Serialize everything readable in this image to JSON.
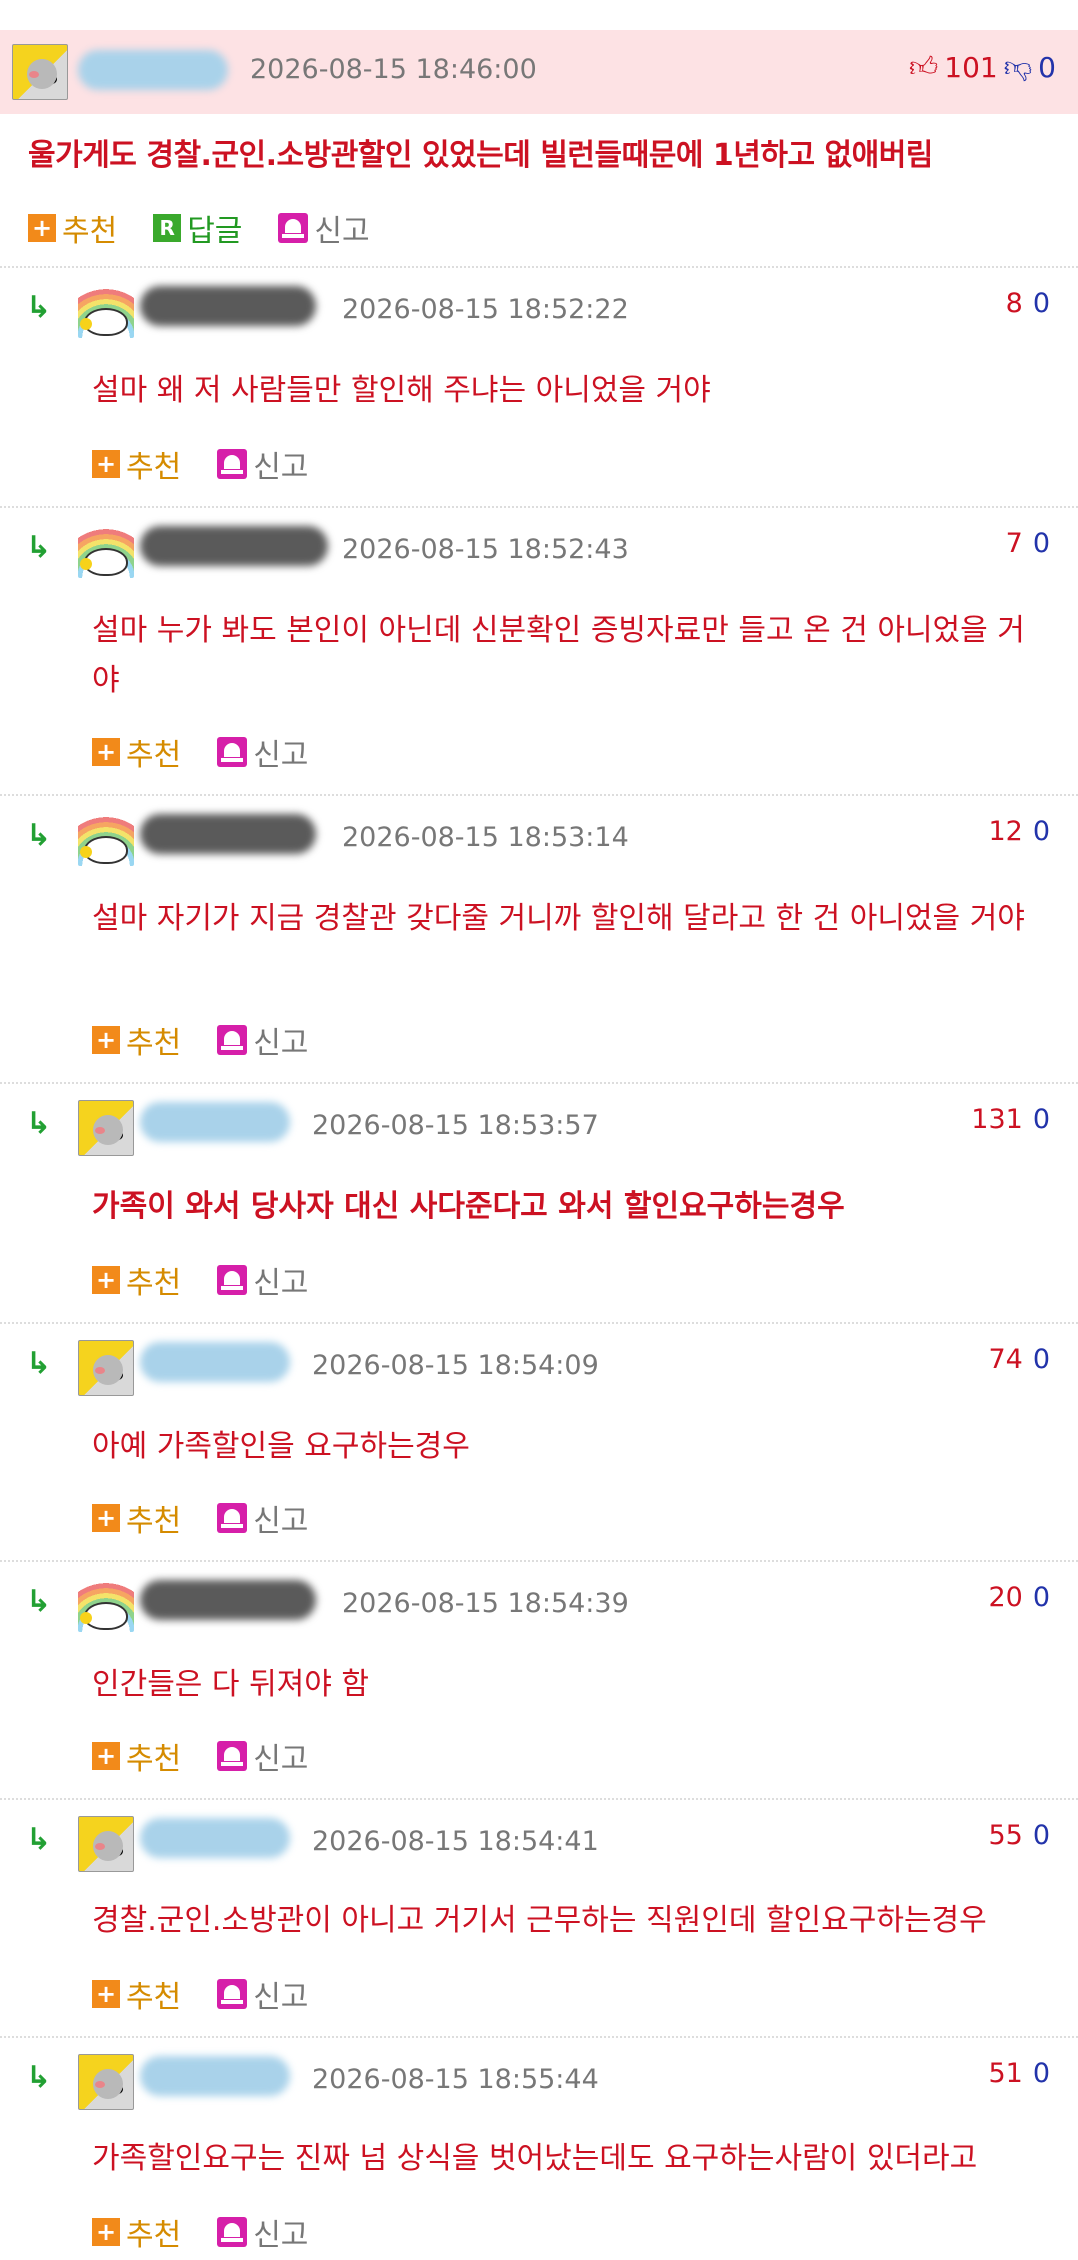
{
  "post": {
    "date": "2026-08-15 18:46:00",
    "up_count": "101",
    "down_count": "0",
    "title": "울가게도 경찰.군인.소방관할인 있었는데 빌런들때문에 1년하고 없애버림",
    "actions": {
      "recommend": "추천",
      "reply": "답글",
      "report": "신고"
    }
  },
  "comment_actions": {
    "recommend": "추천",
    "report": "신고"
  },
  "comments": [
    {
      "date": "2026-08-15 18:52:22",
      "up": "8",
      "down": "0",
      "text": "설마 왜 저 사람들만 할인해 주냐는 아니었을 거야"
    },
    {
      "date": "2026-08-15 18:52:43",
      "up": "7",
      "down": "0",
      "text": "설마 누가 봐도 본인이 아닌데 신분확인 증빙자료만 들고 온 건 아니었을 거야"
    },
    {
      "date": "2026-08-15 18:53:14",
      "up": "12",
      "down": "0",
      "text": "설마 자기가 지금 경찰관 갖다줄 거니까 할인해 달라고 한 건 아니었을 거야"
    },
    {
      "date": "2026-08-15 18:53:57",
      "up": "131",
      "down": "0",
      "text": "가족이 와서 당사자 대신 사다준다고 와서 할인요구하는경우"
    },
    {
      "date": "2026-08-15 18:54:09",
      "up": "74",
      "down": "0",
      "text": "아예 가족할인을 요구하는경우"
    },
    {
      "date": "2026-08-15 18:54:39",
      "up": "20",
      "down": "0",
      "text": "인간들은 다 뒤져야 함"
    },
    {
      "date": "2026-08-15 18:54:41",
      "up": "55",
      "down": "0",
      "text": "경찰.군인.소방관이 아니고 거기서 근무하는 직원인데 할인요구하는경우"
    },
    {
      "date": "2026-08-15 18:55:44",
      "up": "51",
      "down": "0",
      "text": "가족할인요구는 진짜 넘 상식을 벗어났는데도 요구하는사람이 있더라고"
    }
  ]
}
